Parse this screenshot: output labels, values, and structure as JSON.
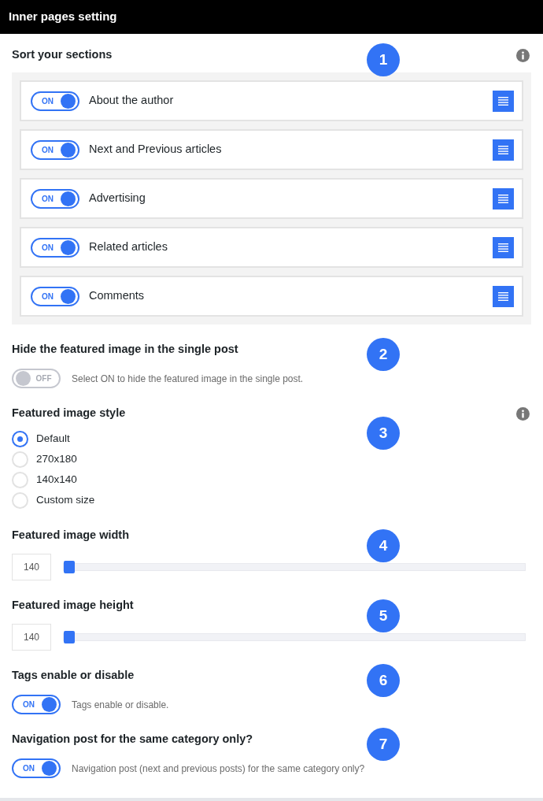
{
  "header": {
    "title": "Inner pages setting"
  },
  "sections": [
    {
      "kind": "sortable",
      "title": "Sort your sections",
      "badge": "1",
      "info": true,
      "items": [
        {
          "label": "About the author",
          "toggle": {
            "on": true,
            "text": "ON"
          }
        },
        {
          "label": "Next and Previous articles",
          "toggle": {
            "on": true,
            "text": "ON"
          }
        },
        {
          "label": "Advertising",
          "toggle": {
            "on": true,
            "text": "ON"
          }
        },
        {
          "label": "Related articles",
          "toggle": {
            "on": true,
            "text": "ON"
          }
        },
        {
          "label": "Comments",
          "toggle": {
            "on": true,
            "text": "ON"
          }
        }
      ]
    },
    {
      "kind": "toggle",
      "title": "Hide the featured image in the single post",
      "badge": "2",
      "info": false,
      "toggle": {
        "on": false,
        "text": "OFF"
      },
      "description": "Select ON to hide the featured image in the single post."
    },
    {
      "kind": "radio",
      "title": "Featured image style",
      "badge": "3",
      "info": true,
      "options": [
        {
          "label": "Default",
          "selected": true
        },
        {
          "label": "270x180",
          "selected": false
        },
        {
          "label": "140x140",
          "selected": false
        },
        {
          "label": "Custom size",
          "selected": false
        }
      ]
    },
    {
      "kind": "slider",
      "title": "Featured image width",
      "badge": "4",
      "info": false,
      "value": "140",
      "level": 0
    },
    {
      "kind": "slider",
      "title": "Featured image height",
      "badge": "5",
      "info": false,
      "value": "140",
      "level": 0
    },
    {
      "kind": "toggle",
      "title": "Tags enable or disable",
      "badge": "6",
      "info": false,
      "toggle": {
        "on": true,
        "text": "ON"
      },
      "description": "Tags enable or disable."
    },
    {
      "kind": "toggle",
      "title": "Navigation post for the same category only?",
      "badge": "7",
      "info": false,
      "toggle": {
        "on": true,
        "text": "ON"
      },
      "description": "Navigation post (next and previous posts) for the same category only?"
    }
  ]
}
